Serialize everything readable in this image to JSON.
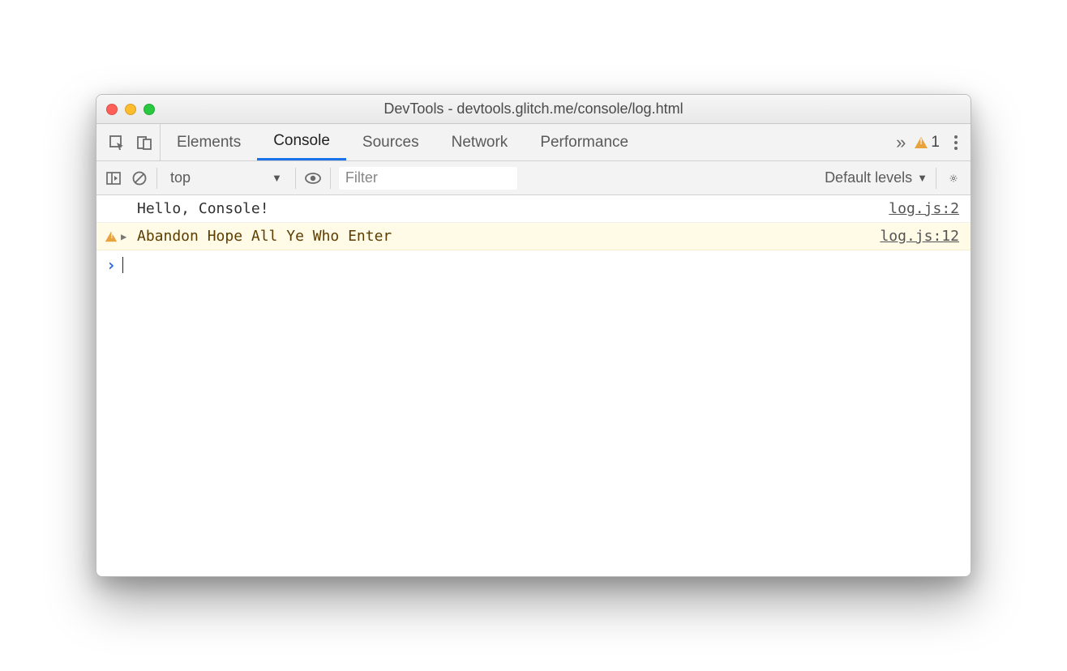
{
  "window": {
    "title": "DevTools - devtools.glitch.me/console/log.html"
  },
  "tabs": {
    "items": [
      "Elements",
      "Console",
      "Sources",
      "Network",
      "Performance"
    ],
    "active_index": 1,
    "warning_count": "1"
  },
  "subbar": {
    "context": "top",
    "filter_placeholder": "Filter",
    "levels_label": "Default levels"
  },
  "console": {
    "rows": [
      {
        "type": "log",
        "text": "Hello, Console!",
        "source": "log.js:2"
      },
      {
        "type": "warning",
        "text": "Abandon Hope All Ye Who Enter",
        "source": "log.js:12"
      }
    ]
  }
}
